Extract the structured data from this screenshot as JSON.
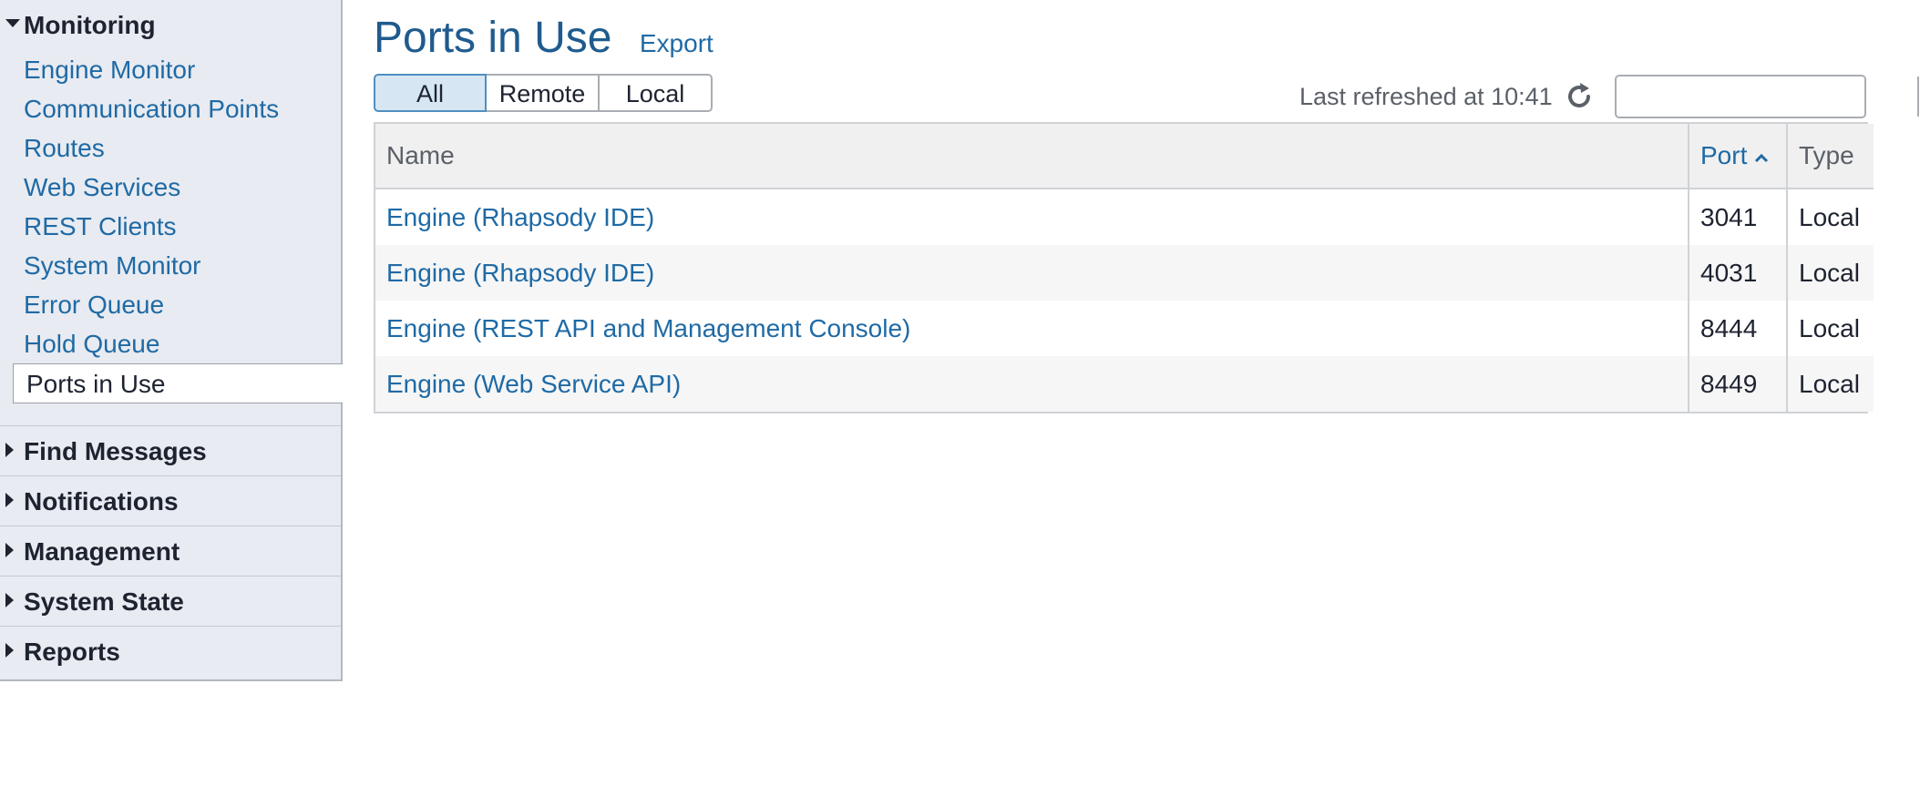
{
  "sidebar": {
    "monitoring": {
      "title": "Monitoring",
      "items": [
        {
          "label": "Engine Monitor"
        },
        {
          "label": "Communication Points"
        },
        {
          "label": "Routes"
        },
        {
          "label": "Web Services"
        },
        {
          "label": "REST Clients"
        },
        {
          "label": "System Monitor"
        },
        {
          "label": "Error Queue"
        },
        {
          "label": "Hold Queue"
        },
        {
          "label": "Ports in Use"
        }
      ]
    },
    "groups": [
      {
        "label": "Find Messages"
      },
      {
        "label": "Notifications"
      },
      {
        "label": "Management"
      },
      {
        "label": "System State"
      },
      {
        "label": "Reports"
      }
    ]
  },
  "header": {
    "title": "Ports in Use",
    "export_label": "Export"
  },
  "filters": {
    "all": "All",
    "remote": "Remote",
    "local": "Local",
    "selected": "All"
  },
  "status": {
    "last_refreshed": "Last refreshed at 10:41"
  },
  "search": {
    "value": "",
    "placeholder": ""
  },
  "table": {
    "columns": {
      "name": "Name",
      "port": "Port",
      "type": "Type"
    },
    "sort": {
      "column": "Port",
      "direction": "ascending"
    },
    "rows": [
      {
        "name": "Engine (Rhapsody IDE)",
        "port": "3041",
        "type": "Local"
      },
      {
        "name": "Engine (Rhapsody IDE)",
        "port": "4031",
        "type": "Local"
      },
      {
        "name": "Engine (REST API and Management Console)",
        "port": "8444",
        "type": "Local"
      },
      {
        "name": "Engine (Web Service API)",
        "port": "8449",
        "type": "Local"
      }
    ]
  },
  "colors": {
    "link": "#1f6aa5",
    "title": "#1f5b8e",
    "sidebar_bg": "#e8ebf1",
    "active_filter_bg": "#d6e6f3"
  },
  "icons": {
    "refresh": "refresh-icon",
    "search": "search-icon",
    "sort": "chevron-up-icon",
    "expanded": "triangle-down-icon",
    "collapsed": "triangle-right-icon"
  }
}
